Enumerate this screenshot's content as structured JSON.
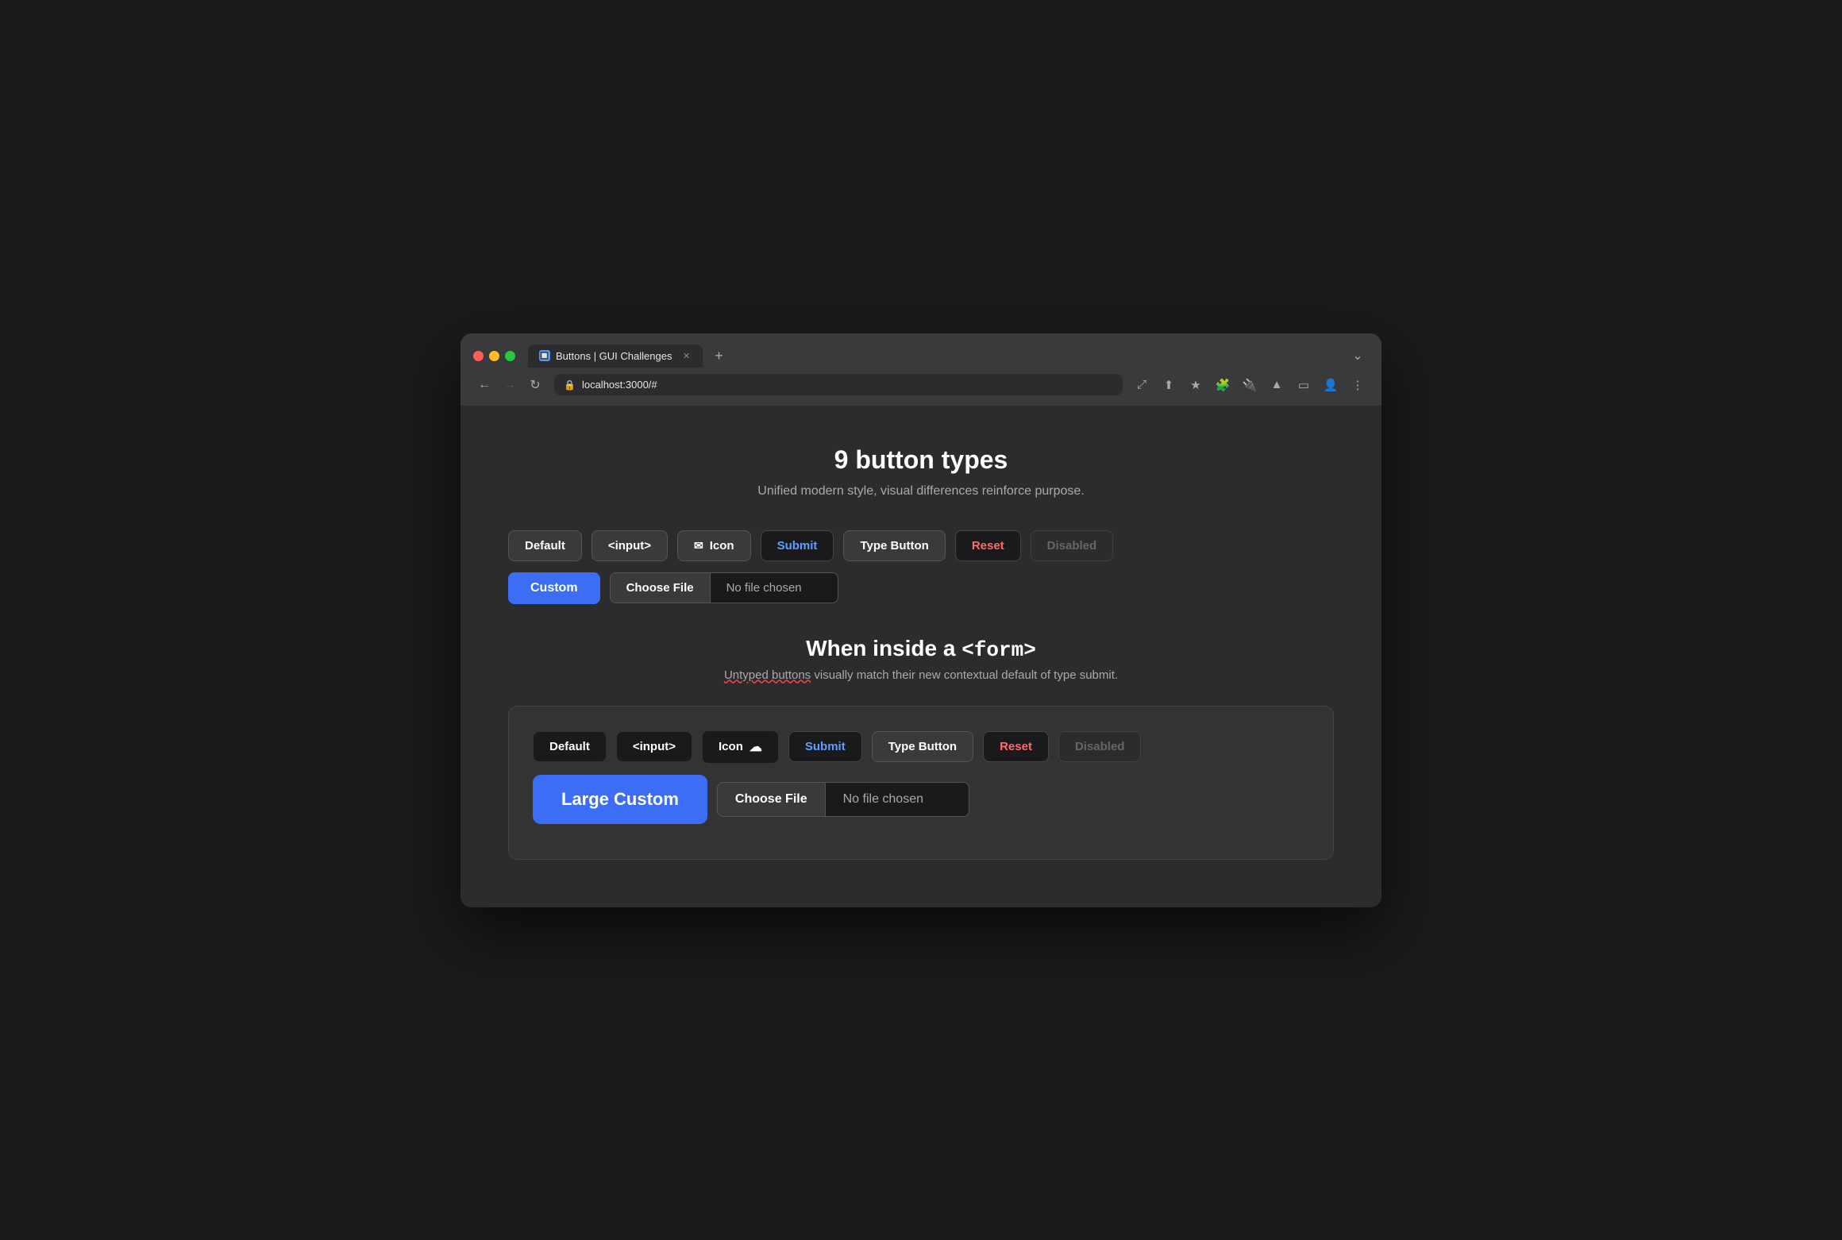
{
  "browser": {
    "tab_title": "Buttons | GUI Challenges",
    "tab_favicon": "🔲",
    "address": "localhost:3000/#",
    "new_tab_symbol": "+",
    "close_symbol": "✕",
    "chevron_symbol": "⌄",
    "nav": {
      "back": "←",
      "forward": "→",
      "reload": "↻"
    }
  },
  "page": {
    "title": "9 button types",
    "subtitle": "Unified modern style, visual differences reinforce purpose."
  },
  "section1": {
    "buttons": {
      "default": "Default",
      "input": "<input>",
      "icon": "Icon",
      "submit": "Submit",
      "type_button": "Type Button",
      "reset": "Reset",
      "disabled": "Disabled",
      "custom": "Custom",
      "choose_file": "Choose File",
      "no_file_chosen": "No file chosen"
    }
  },
  "section2": {
    "title_text": "When inside a ",
    "title_code": "<form>",
    "subtitle_part1": "Untyped buttons",
    "subtitle_part2": " visually match their new contextual default of type submit.",
    "buttons": {
      "default": "Default",
      "input": "<input>",
      "icon": "Icon",
      "submit": "Submit",
      "type_button": "Type Button",
      "reset": "Reset",
      "disabled": "Disabled",
      "large_custom": "Large Custom",
      "choose_file": "Choose File",
      "no_file_chosen": "No file chosen"
    }
  }
}
